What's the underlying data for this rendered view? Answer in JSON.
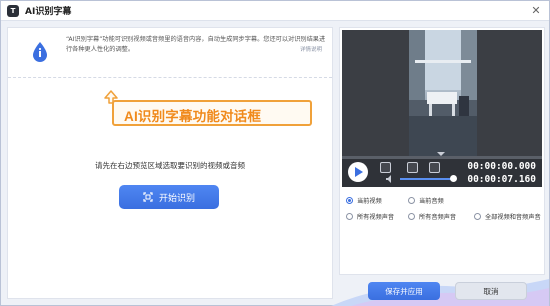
{
  "window": {
    "title": "AI识别字幕",
    "logo_text": "T",
    "close_icon": "close-icon"
  },
  "info": {
    "icon": "info-drop-icon",
    "text": "“AI识别字幕”功能可识别视频或音频里的语音内容，自动生成同步字幕。您还可以对识别结果进行各种更人性化的调整。",
    "link": "详情说明"
  },
  "callout": {
    "text": "AI识别字幕功能对话框",
    "color": "#f08a1c"
  },
  "main": {
    "prompt": "请先在右边预览区域选取要识别的视频或音频",
    "start_button": "开始识别"
  },
  "player": {
    "time_current": "00:00:00.000",
    "time_total": "00:00:07.160"
  },
  "options": [
    {
      "label": "当前视频",
      "checked": true
    },
    {
      "label": "当前音频",
      "checked": false
    },
    {
      "label": "所有视频声音",
      "checked": false
    },
    {
      "label": "所有音频声音",
      "checked": false
    },
    {
      "label": "全部视频和音频声音",
      "checked": false
    }
  ],
  "footer": {
    "save_button": "保存并应用",
    "cancel_button": "取消"
  },
  "colors": {
    "accent": "#3b6fe0",
    "callout_border": "#f0a13a"
  }
}
